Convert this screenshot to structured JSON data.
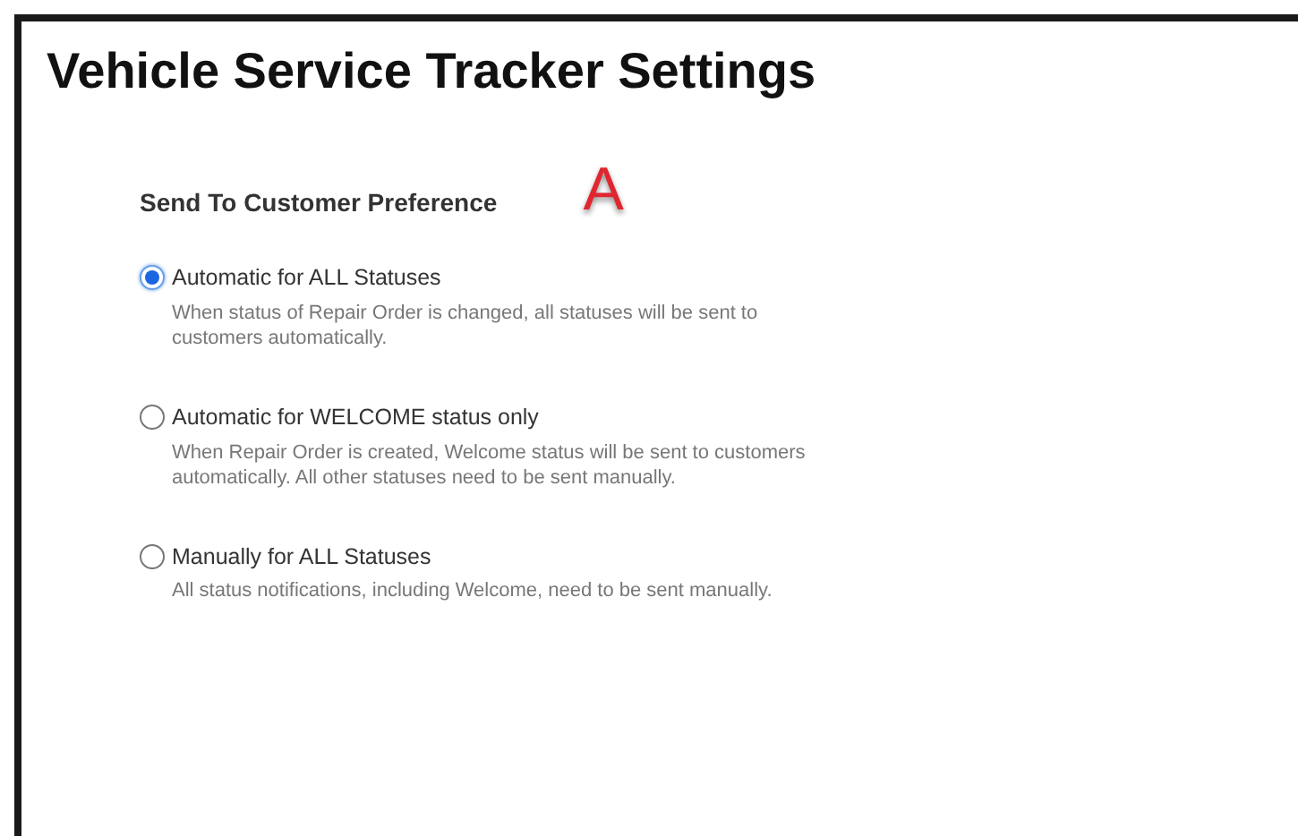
{
  "title": "Vehicle Service Tracker Settings",
  "section": {
    "heading": "Send To Customer Preference",
    "marker": "A"
  },
  "options": [
    {
      "label": "Automatic for ALL Statuses",
      "description": "When status of Repair Order is changed, all statuses will be sent to customers automatically.",
      "selected": true
    },
    {
      "label": "Automatic for WELCOME status only",
      "description": "When Repair Order is created, Welcome status will be sent to customers automatically. All other statuses need to be sent manually.",
      "selected": false
    },
    {
      "label": "Manually for ALL Statuses",
      "description": "All status notifications, including Welcome, need to be sent manually.",
      "selected": false
    }
  ]
}
